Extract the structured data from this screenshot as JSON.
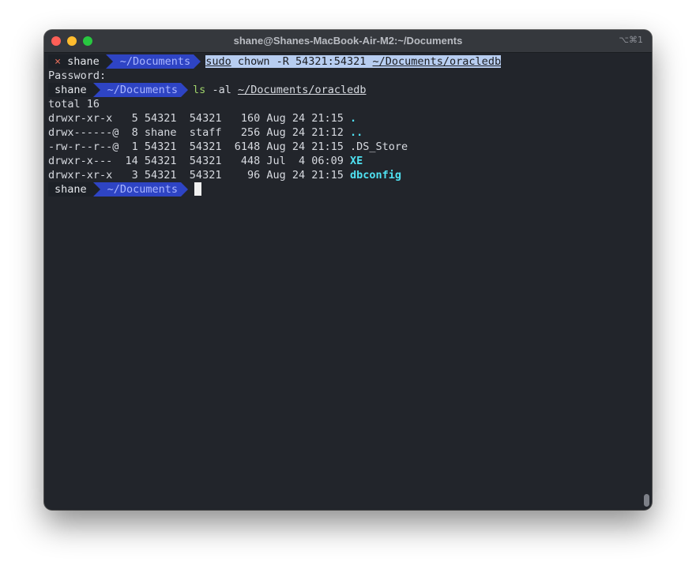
{
  "window": {
    "title": "shane@Shanes-MacBook-Air-M2:~/Documents",
    "shortcut": "⌥⌘1"
  },
  "prompt": {
    "error_mark": "×",
    "user": "shane",
    "dir": "~/Documents"
  },
  "commands": {
    "first": {
      "program": "sudo",
      "args": " chown -R 54321:54321 ",
      "path": "~/Documents/oracledb"
    },
    "password_prompt": "Password:",
    "second": {
      "program": "ls",
      "args": " -al ",
      "path": "~/Documents/oracledb"
    }
  },
  "listing": {
    "total": "total 16",
    "rows": [
      {
        "meta": "drwxr-xr-x   5 54321  54321   160 Aug 24 21:15 ",
        "name": ".",
        "style": "cyan-bold"
      },
      {
        "meta": "drwx------@  8 shane  staff   256 Aug 24 21:12 ",
        "name": "..",
        "style": "cyan-bold"
      },
      {
        "meta": "-rw-r--r--@  1 54321  54321  6148 Aug 24 21:15 ",
        "name": ".DS_Store",
        "style": "plain"
      },
      {
        "meta": "drwxr-x---  14 54321  54321   448 Jul  4 06:09 ",
        "name": "XE",
        "style": "cyan-bold"
      },
      {
        "meta": "drwxr-xr-x   3 54321  54321    96 Aug 24 21:15 ",
        "name": "dbconfig",
        "style": "cyan-bold"
      }
    ]
  }
}
